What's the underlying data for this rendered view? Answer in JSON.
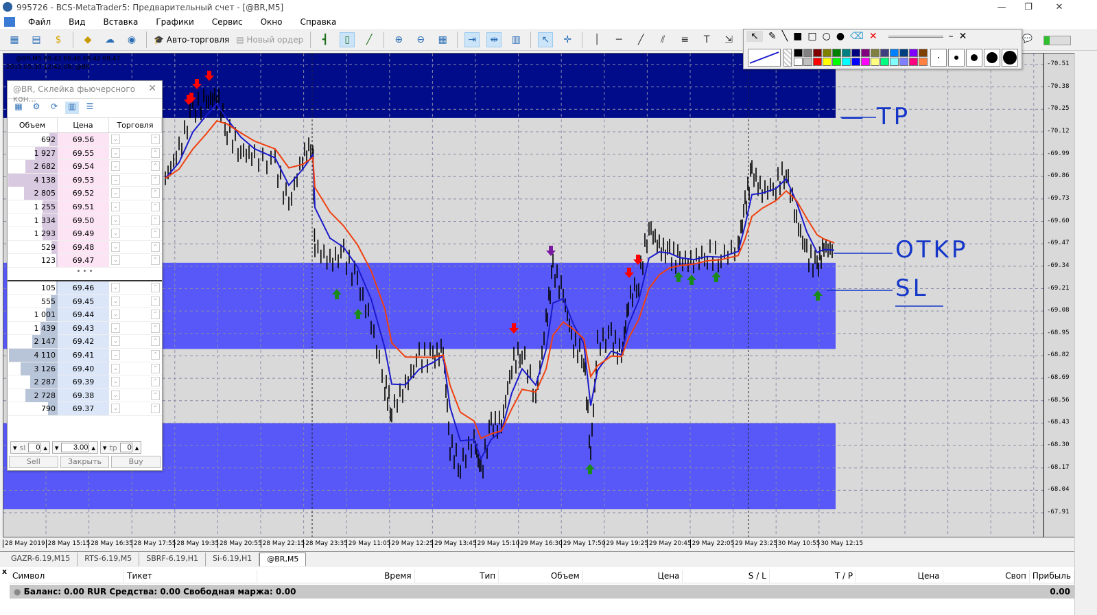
{
  "window": {
    "title": "995726 - BCS-MetaTrader5: Предварительный счет - [@BR,M5]"
  },
  "menu": [
    "Файл",
    "Вид",
    "Вставка",
    "Графики",
    "Сервис",
    "Окно",
    "Справка"
  ],
  "toolbar": {
    "auto_trading": "Авто-торговля",
    "new_order": "Новый ордер"
  },
  "chart": {
    "header_line1": "@BR,M5  69.43 69.46 69.42 69.47",
    "header_line2": "2019.05.30 12:42:08; @BR",
    "price_ticks": [
      "70.51",
      "70.38",
      "70.25",
      "70.12",
      "69.99",
      "69.86",
      "69.73",
      "69.60",
      "69.47",
      "69.34",
      "69.21",
      "69.08",
      "68.95",
      "68.82",
      "68.69",
      "68.56",
      "68.43",
      "68.30",
      "68.17",
      "68.04",
      "67.91"
    ],
    "time_ticks": [
      "28 May 2019",
      "28 May 15:15",
      "28 May 16:35",
      "28 May 17:55",
      "28 May 19:35",
      "28 May 20:55",
      "28 May 22:15",
      "28 May 23:35",
      "29 May 11:05",
      "29 May 12:25",
      "29 May 13:45",
      "29 May 15:10",
      "29 May 16:30",
      "29 May 17:50",
      "29 May 19:25",
      "29 May 20:45",
      "29 May 22:05",
      "29 May 23:25",
      "30 May 10:55",
      "30 May 12:15"
    ],
    "price_path": [
      69.85,
      70.01,
      70.25,
      70.29,
      70.33,
      70.13,
      70.01,
      69.97,
      69.93,
      69.69,
      69.97,
      70.05,
      69.45,
      69.37,
      69.41,
      69.25,
      69.01,
      68.65,
      68.5,
      68.65,
      68.81,
      68.81,
      68.85,
      68.3,
      68.18,
      68.34,
      68.14,
      68.42,
      68.42,
      68.77,
      68.85,
      68.58,
      69.01,
      69.33,
      69.17,
      68.89,
      68.81,
      68.26,
      68.89,
      68.93,
      68.81,
      69.13,
      69.25,
      69.57,
      69.45,
      69.41,
      69.37,
      69.37,
      69.41,
      69.39,
      69.45,
      69.69,
      69.89,
      69.77,
      69.81,
      69.89,
      69.61,
      69.41,
      69.33,
      69.45,
      69.43
    ],
    "zones": [
      {
        "from": 70.2,
        "to": 70.6,
        "color": "#000c8a"
      },
      {
        "from": 68.86,
        "to": 69.36,
        "color": "#5858f8"
      },
      {
        "from": 67.93,
        "to": 68.43,
        "color": "#5858f8"
      }
    ],
    "colors": {
      "background": "#d9d9d9",
      "fast_ma": "#1a1acc",
      "slow_ma": "#f04010",
      "sell_arrow": "#ff0000",
      "buy_arrow": "#1a8a1a",
      "purple_arrow": "#7a1aa0",
      "annotation": "#1436c8"
    },
    "annotations": {
      "tp": "TP",
      "open": "OTKP",
      "sl": "SL"
    }
  },
  "order_book": {
    "title": "@BR, Склейка фьючерсного кон...",
    "columns": [
      "Объем",
      "Цена",
      "Торговля"
    ],
    "asks": [
      [
        "692",
        "69.56"
      ],
      [
        "1 927",
        "69.55"
      ],
      [
        "2 682",
        "69.54"
      ],
      [
        "4 138",
        "69.53"
      ],
      [
        "2 805",
        "69.52"
      ],
      [
        "1 255",
        "69.51"
      ],
      [
        "1 334",
        "69.50"
      ],
      [
        "1 293",
        "69.49"
      ],
      [
        "529",
        "69.48"
      ],
      [
        "123",
        "69.47"
      ]
    ],
    "bids": [
      [
        "105",
        "69.46"
      ],
      [
        "555",
        "69.45"
      ],
      [
        "1 001",
        "69.44"
      ],
      [
        "1 439",
        "69.43"
      ],
      [
        "2 147",
        "69.42"
      ],
      [
        "4 110",
        "69.41"
      ],
      [
        "3 126",
        "69.40"
      ],
      [
        "2 287",
        "69.39"
      ],
      [
        "2 728",
        "69.38"
      ],
      [
        "790",
        "69.37"
      ]
    ],
    "separator": "• • •",
    "sl_label": "sl",
    "sl_value": "0",
    "volume": "3.00",
    "tp_label": "tp",
    "tp_value": "0",
    "sell": "Sell",
    "close": "Закрыть",
    "buy": "Buy"
  },
  "tabs": [
    {
      "label": "GAZR-6.19,M15"
    },
    {
      "label": "RTS-6.19,M5"
    },
    {
      "label": "SBRF-6.19,H1"
    },
    {
      "label": "Si-6.19,H1"
    },
    {
      "label": "@BR,M5",
      "active": true
    }
  ],
  "terminal": {
    "columns": [
      "Символ",
      "Тикет",
      "Время",
      "Тип",
      "Объем",
      "Цена",
      "S / L",
      "T / P",
      "Цена",
      "Своп",
      "Прибыль"
    ],
    "balance": "Баланс: 0.00 RUR  Средства: 0.00  Свободная маржа: 0.00",
    "profit": "0.00"
  }
}
